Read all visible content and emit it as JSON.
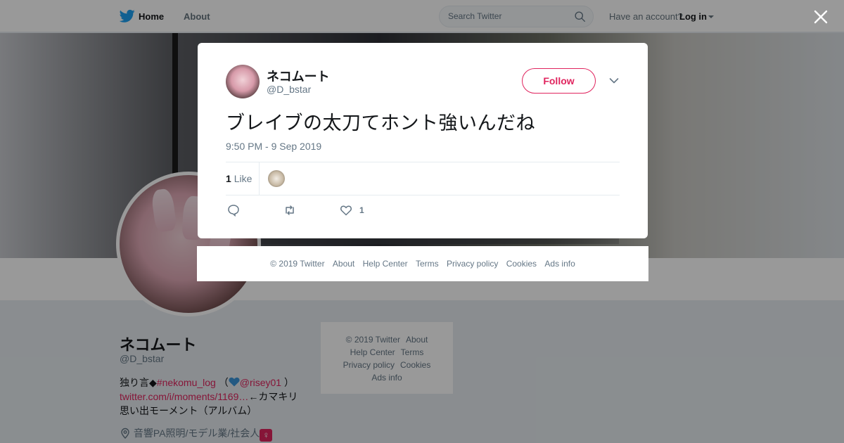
{
  "topbar": {
    "home": "Home",
    "about": "About",
    "search_placeholder": "Search Twitter",
    "account_prompt": "Have an account?",
    "login": "Log in"
  },
  "profile": {
    "name": "ネコムート",
    "handle": "@D_bstar",
    "bio_prefix": "独り言◆",
    "bio_hashtag": "#nekomu_log",
    "bio_open": "（",
    "bio_mention": "@risey01",
    "bio_close": "）",
    "bio_link": "twitter.com/i/moments/1169…",
    "bio_link_suffix": "←カマキリ",
    "bio_line3": "思い出モーメント（アルバム）",
    "location": "音響PA照明/モデル業/社会人"
  },
  "side_footer": {
    "copyright": "© 2019 Twitter",
    "about": "About",
    "help": "Help Center",
    "terms": "Terms",
    "privacy": "Privacy policy",
    "cookies": "Cookies",
    "ads": "Ads info"
  },
  "tweet": {
    "author_name": "ネコムート",
    "author_handle": "@D_bstar",
    "follow_label": "Follow",
    "text": "ブレイブの太刀てホント強いんだね",
    "timestamp": "9:50 PM - 9 Sep 2019",
    "like_count": "1",
    "like_label": "Like",
    "action_like_count": "1"
  },
  "modal_footer": {
    "copyright": "© 2019 Twitter",
    "about": "About",
    "help": "Help Center",
    "terms": "Terms",
    "privacy": "Privacy policy",
    "cookies": "Cookies",
    "ads": "Ads info"
  },
  "colors": {
    "accent": "#e0245e",
    "brand": "#1da1f2",
    "muted": "#657786"
  }
}
